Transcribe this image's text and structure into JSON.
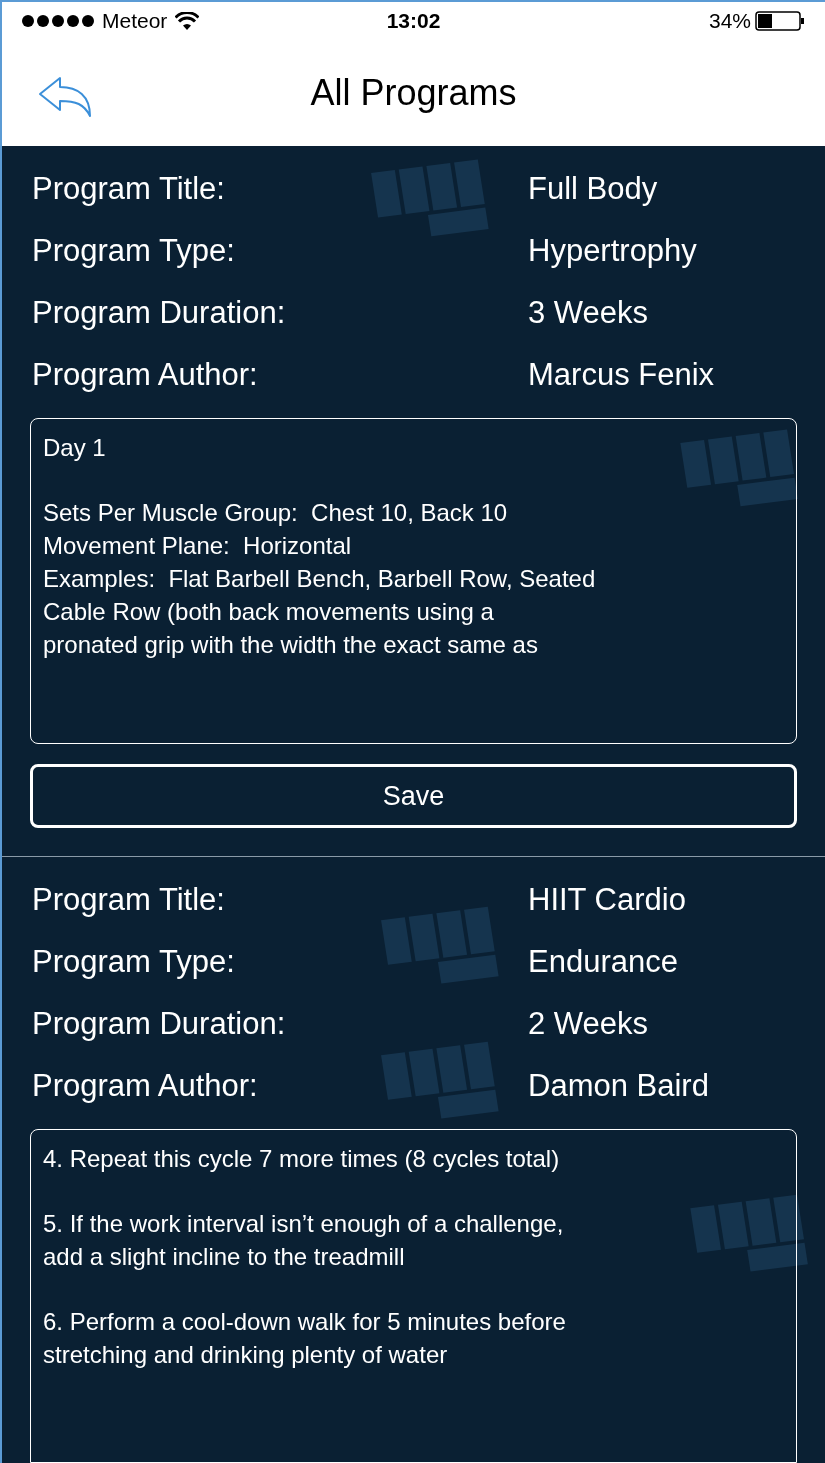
{
  "status_bar": {
    "carrier": "Meteor",
    "time": "13:02",
    "battery": "34%"
  },
  "header": {
    "title": "All Programs"
  },
  "programs": [
    {
      "fields": [
        {
          "label": "Program Title:",
          "value": "Full Body"
        },
        {
          "label": "Program Type:",
          "value": "Hypertrophy"
        },
        {
          "label": "Program Duration:",
          "value": "3 Weeks"
        },
        {
          "label": "Program Author:",
          "value": "Marcus Fenix"
        }
      ],
      "notes": [
        "Day 1",
        "Sets Per Muscle Group:  Chest 10, Back 10\nMovement Plane:  Horizontal\nExamples:  Flat Barbell Bench, Barbell Row, Seated\nCable Row (both back movements using a\npronated grip with the width the exact same as"
      ],
      "save_button": "Save"
    },
    {
      "fields": [
        {
          "label": "Program Title:",
          "value": "HIIT Cardio"
        },
        {
          "label": "Program Type:",
          "value": "Endurance"
        },
        {
          "label": "Program Duration:",
          "value": "2 Weeks"
        },
        {
          "label": "Program Author:",
          "value": "Damon Baird"
        }
      ],
      "notes": [
        "4. Repeat this cycle 7 more times (8 cycles total)",
        "5. If the work interval isn’t enough of a challenge,\nadd a slight incline to the treadmill",
        "6. Perform a cool-down walk for 5 minutes before\nstretching and drinking plenty of water"
      ]
    }
  ]
}
